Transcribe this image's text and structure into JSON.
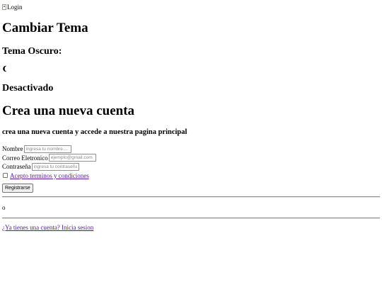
{
  "header": {
    "logo_alt": "Login"
  },
  "theme": {
    "title": "Cambiar Tema",
    "dark_label": "Tema Oscuro:",
    "toggle_icon": "moon-icon",
    "status": "Desactivado"
  },
  "signup": {
    "title": "Crea una nueva cuenta",
    "subtitle": "crea una nueva cuenta y accede a nuestra pagina principal",
    "fields": {
      "name_label": "Nombre",
      "name_placeholder": "ingresa tu nombre....",
      "email_label": "Correo Eletronico",
      "email_placeholder": "ejemplo@gmail.com",
      "password_label": "Contraseña",
      "password_placeholder": "ingresa tu contraseña"
    },
    "terms_label": "Acepto terminos y condiciones",
    "submit_label": "Registrarse"
  },
  "separator": {
    "or_text": "o"
  },
  "login": {
    "link_text": "¿Ya tienes una cuenta? Inicia sesion"
  }
}
